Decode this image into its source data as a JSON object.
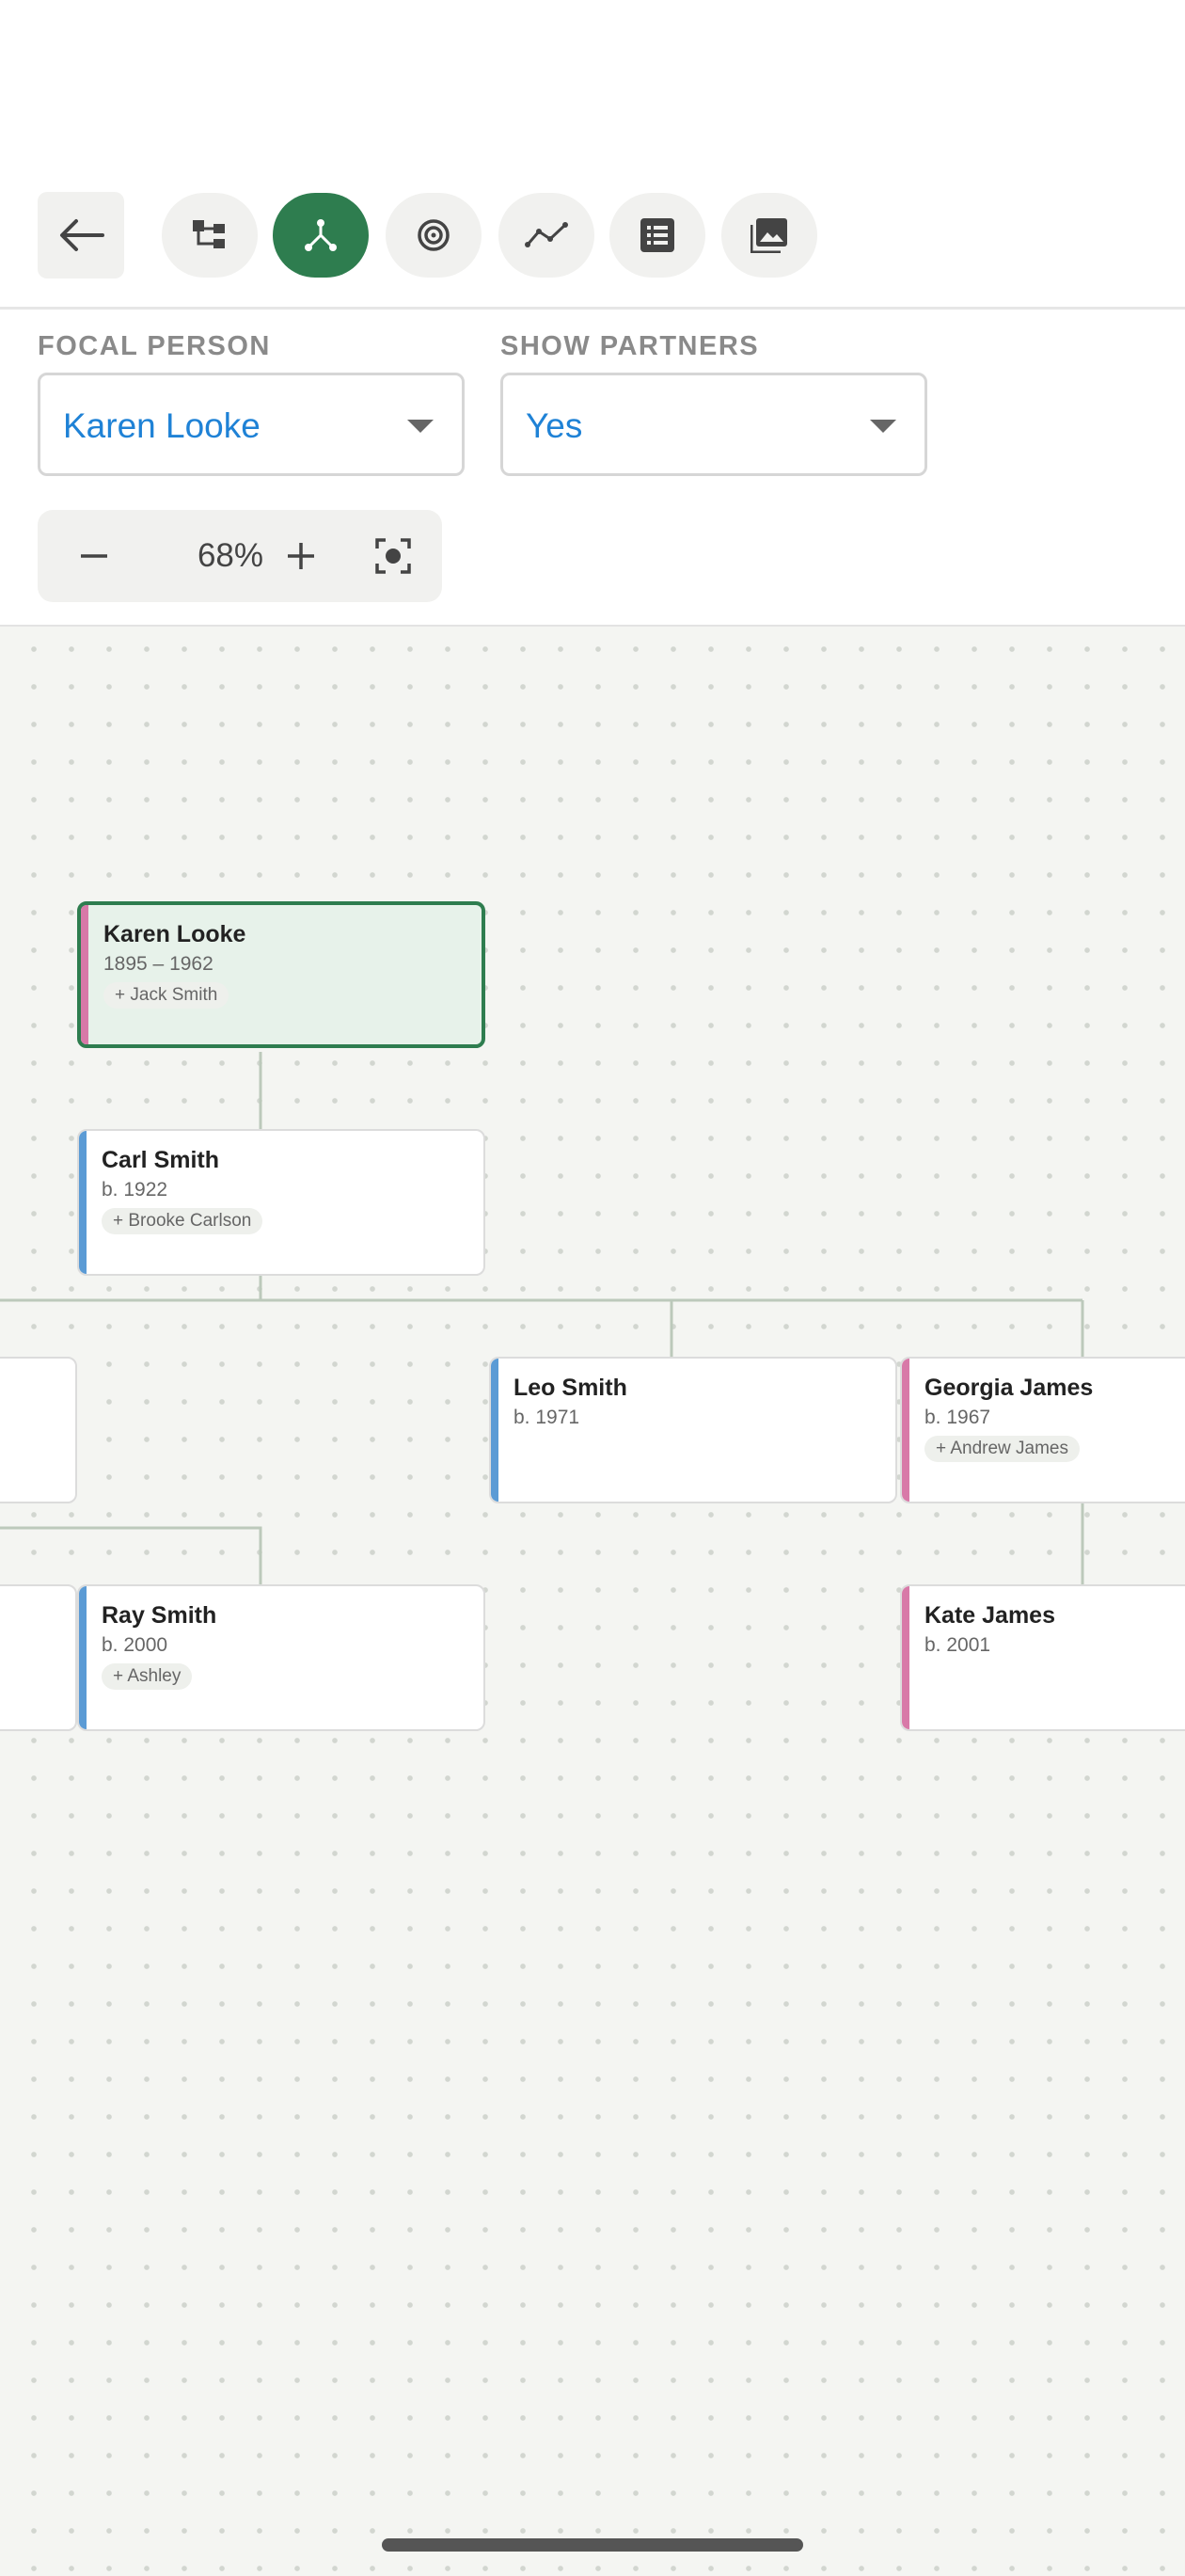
{
  "toolbar": {
    "back": {
      "icon": "arrow-left-icon"
    },
    "views": [
      {
        "name": "tree-view",
        "icon": "org-chart-icon",
        "active": false
      },
      {
        "name": "descendants-view",
        "icon": "fork-node-icon",
        "active": true
      },
      {
        "name": "fan-view",
        "icon": "target-icon",
        "active": false
      },
      {
        "name": "timeline-view",
        "icon": "line-chart-icon",
        "active": false
      },
      {
        "name": "list-view",
        "icon": "list-icon",
        "active": false
      },
      {
        "name": "gallery-view",
        "icon": "image-icon",
        "active": false
      }
    ],
    "active_color": "#2e7d4f"
  },
  "controls": {
    "focal_person": {
      "label": "FOCAL PERSON",
      "value": "Karen Looke"
    },
    "show_partners": {
      "label": "SHOW PARTNERS",
      "value": "Yes"
    },
    "zoom": {
      "value": "68%",
      "minus_icon": "minus-icon",
      "plus_icon": "plus-icon",
      "fit_icon": "fit-screen-icon"
    }
  },
  "people": [
    {
      "id": "karen",
      "name": "Karen Looke",
      "dates": "1895 – 1962",
      "partner": "+ Jack Smith",
      "gender": "female",
      "focal": true
    },
    {
      "id": "carl",
      "name": "Carl Smith",
      "dates": "b. 1922",
      "partner": "+ Brooke Carlson",
      "gender": "male",
      "focal": false
    },
    {
      "id": "hidden",
      "name": "",
      "dates": "",
      "partner": "",
      "gender": "",
      "focal": false
    },
    {
      "id": "leo",
      "name": "Leo Smith",
      "dates": "b. 1971",
      "partner": "",
      "gender": "male",
      "focal": false
    },
    {
      "id": "georgia",
      "name": "Georgia James",
      "dates": "b. 1967",
      "partner": "+ Andrew James",
      "gender": "female",
      "focal": false
    },
    {
      "id": "partial",
      "name": "",
      "dates": "",
      "partner": "",
      "gender": "",
      "focal": false
    },
    {
      "id": "ray",
      "name": "Ray Smith",
      "dates": "b. 2000",
      "partner": "+ Ashley",
      "gender": "male",
      "focal": false
    },
    {
      "id": "kate",
      "name": "Kate James",
      "dates": "b. 2001",
      "partner": "",
      "gender": "female",
      "focal": false
    }
  ],
  "colors": {
    "male": "#5b9bd5",
    "female": "#d879a8",
    "connector": "#bcc9bb",
    "link": "#1f82d6"
  }
}
